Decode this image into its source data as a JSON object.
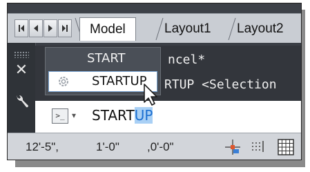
{
  "tabs": [
    {
      "label": "Model",
      "active": true
    },
    {
      "label": "Layout1",
      "active": false
    },
    {
      "label": "Layout2",
      "active": false
    }
  ],
  "history": {
    "line1": "ncel*",
    "line2": "RTUP <Selection"
  },
  "autocomplete": {
    "header": "START",
    "item_label": "STARTUP"
  },
  "command_input": {
    "typed_plain": "START",
    "typed_selected": "UP"
  },
  "status": {
    "x": "12'-5\",",
    "y": "1'-0\"",
    "z": ",0'-0\""
  }
}
